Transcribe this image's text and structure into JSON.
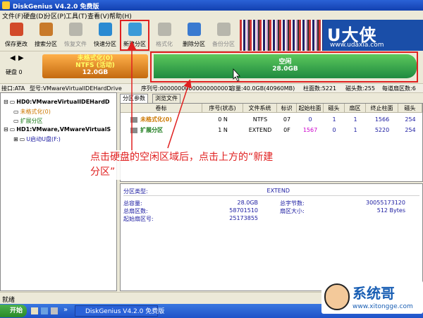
{
  "title_bar": {
    "title": "DiskGenius V4.2.0 免费版"
  },
  "menu": [
    "文件(F)",
    "硬盘(D)",
    "分区(P)",
    "工具(T)",
    "查看(V)",
    "帮助(H)"
  ],
  "toolbar": [
    {
      "label": "保存更改",
      "icon": "save-icon",
      "enabled": true,
      "color": "#d24a2a"
    },
    {
      "label": "搜索分区",
      "icon": "magnifier-icon",
      "enabled": true,
      "color": "#c87a2a"
    },
    {
      "label": "恢复文件",
      "icon": "restore-icon",
      "enabled": false,
      "color": "#777777"
    },
    {
      "label": "快速分区",
      "icon": "quick-partition-icon",
      "enabled": true,
      "color": "#2a8ad2"
    },
    {
      "label": "新建分区",
      "icon": "new-partition-icon",
      "enabled": true,
      "color": "#3a9ad8"
    },
    {
      "label": "格式化",
      "icon": "format-icon",
      "enabled": false,
      "color": "#777777"
    },
    {
      "label": "删除分区",
      "icon": "delete-partition-icon",
      "enabled": true,
      "color": "#3a7ad0"
    },
    {
      "label": "备份分区",
      "icon": "backup-partition-icon",
      "enabled": false,
      "color": "#777777"
    }
  ],
  "banner": {
    "brand": "U大侠",
    "url": "www.udaxia.com"
  },
  "disk_map": {
    "disk_label": "硬盘 0",
    "used_segment": {
      "line1": "未格式化(0)",
      "line2": "NTFS (活动)",
      "line3": "12.0GB"
    },
    "free_segment": {
      "line1": "空闲",
      "line2": "28.0GB"
    }
  },
  "info_bar": {
    "interface": "接口:ATA",
    "model": "型号:VMwareVirtualIDEHardDrive",
    "serial": "序列号:00000000000000000001",
    "capacity": "容量:40.0GB(40960MB)",
    "cylinders": "柱面数:5221",
    "heads": "磁头数:255",
    "sectors": "每道扇区数:6"
  },
  "tree": [
    {
      "text": "HD0:VMwareVirtualIDEHardD",
      "level": 0,
      "toggle": "−",
      "bold": true
    },
    {
      "text": "未格式化(0)",
      "level": 1,
      "color": "#cc7700"
    },
    {
      "text": "扩展分区",
      "level": 1,
      "color": "#1a7a1a"
    },
    {
      "text": "HD1:VMware,VMwareVirtualS",
      "level": 0,
      "toggle": "−",
      "bold": true
    },
    {
      "text": "U启动U盘(F:)",
      "level": 1,
      "color": "#1a1aa0",
      "toggle": "+"
    }
  ],
  "tabs": [
    "分区参数",
    "浏览文件"
  ],
  "table": {
    "headers": [
      "卷标",
      "序号(状态)",
      "文件系统",
      "标识",
      "起始柱面",
      "磁头",
      "扇区",
      "终止柱面",
      "磁头"
    ],
    "rows": [
      {
        "name": "未格式化(0)",
        "color": "#cc7700",
        "cells": [
          "0 N",
          "NTFS",
          "07",
          "0",
          "1",
          "1",
          "1566",
          "254"
        ]
      },
      {
        "name": "扩展分区",
        "color": "#1a7a1a",
        "cells": [
          "1 N",
          "EXTEND",
          "0F",
          "1567",
          "0",
          "1",
          "5220",
          "254"
        ]
      }
    ]
  },
  "details": {
    "type_label": "分区类型:",
    "type_value": "EXTEND",
    "rows": [
      {
        "l1": "总容量:",
        "v1": "28.0GB",
        "l2": "总字节数:",
        "v2": "30055173120"
      },
      {
        "l1": "总扇区数:",
        "v1": "58701510",
        "l2": "扇区大小:",
        "v2": "512 Bytes"
      },
      {
        "l1": "起始扇区号:",
        "v1": "25173855",
        "l2": "",
        "v2": ""
      }
    ]
  },
  "annotation": {
    "text": "点击硬盘的空闲区域后，点击上方的“新建分区”"
  },
  "status": {
    "text": "就绪"
  },
  "taskbar": {
    "start": "开始",
    "task": "DiskGenius V4.2.0 免费版"
  },
  "watermark": {
    "title": "系统哥",
    "url": "www.xitongge.com"
  }
}
